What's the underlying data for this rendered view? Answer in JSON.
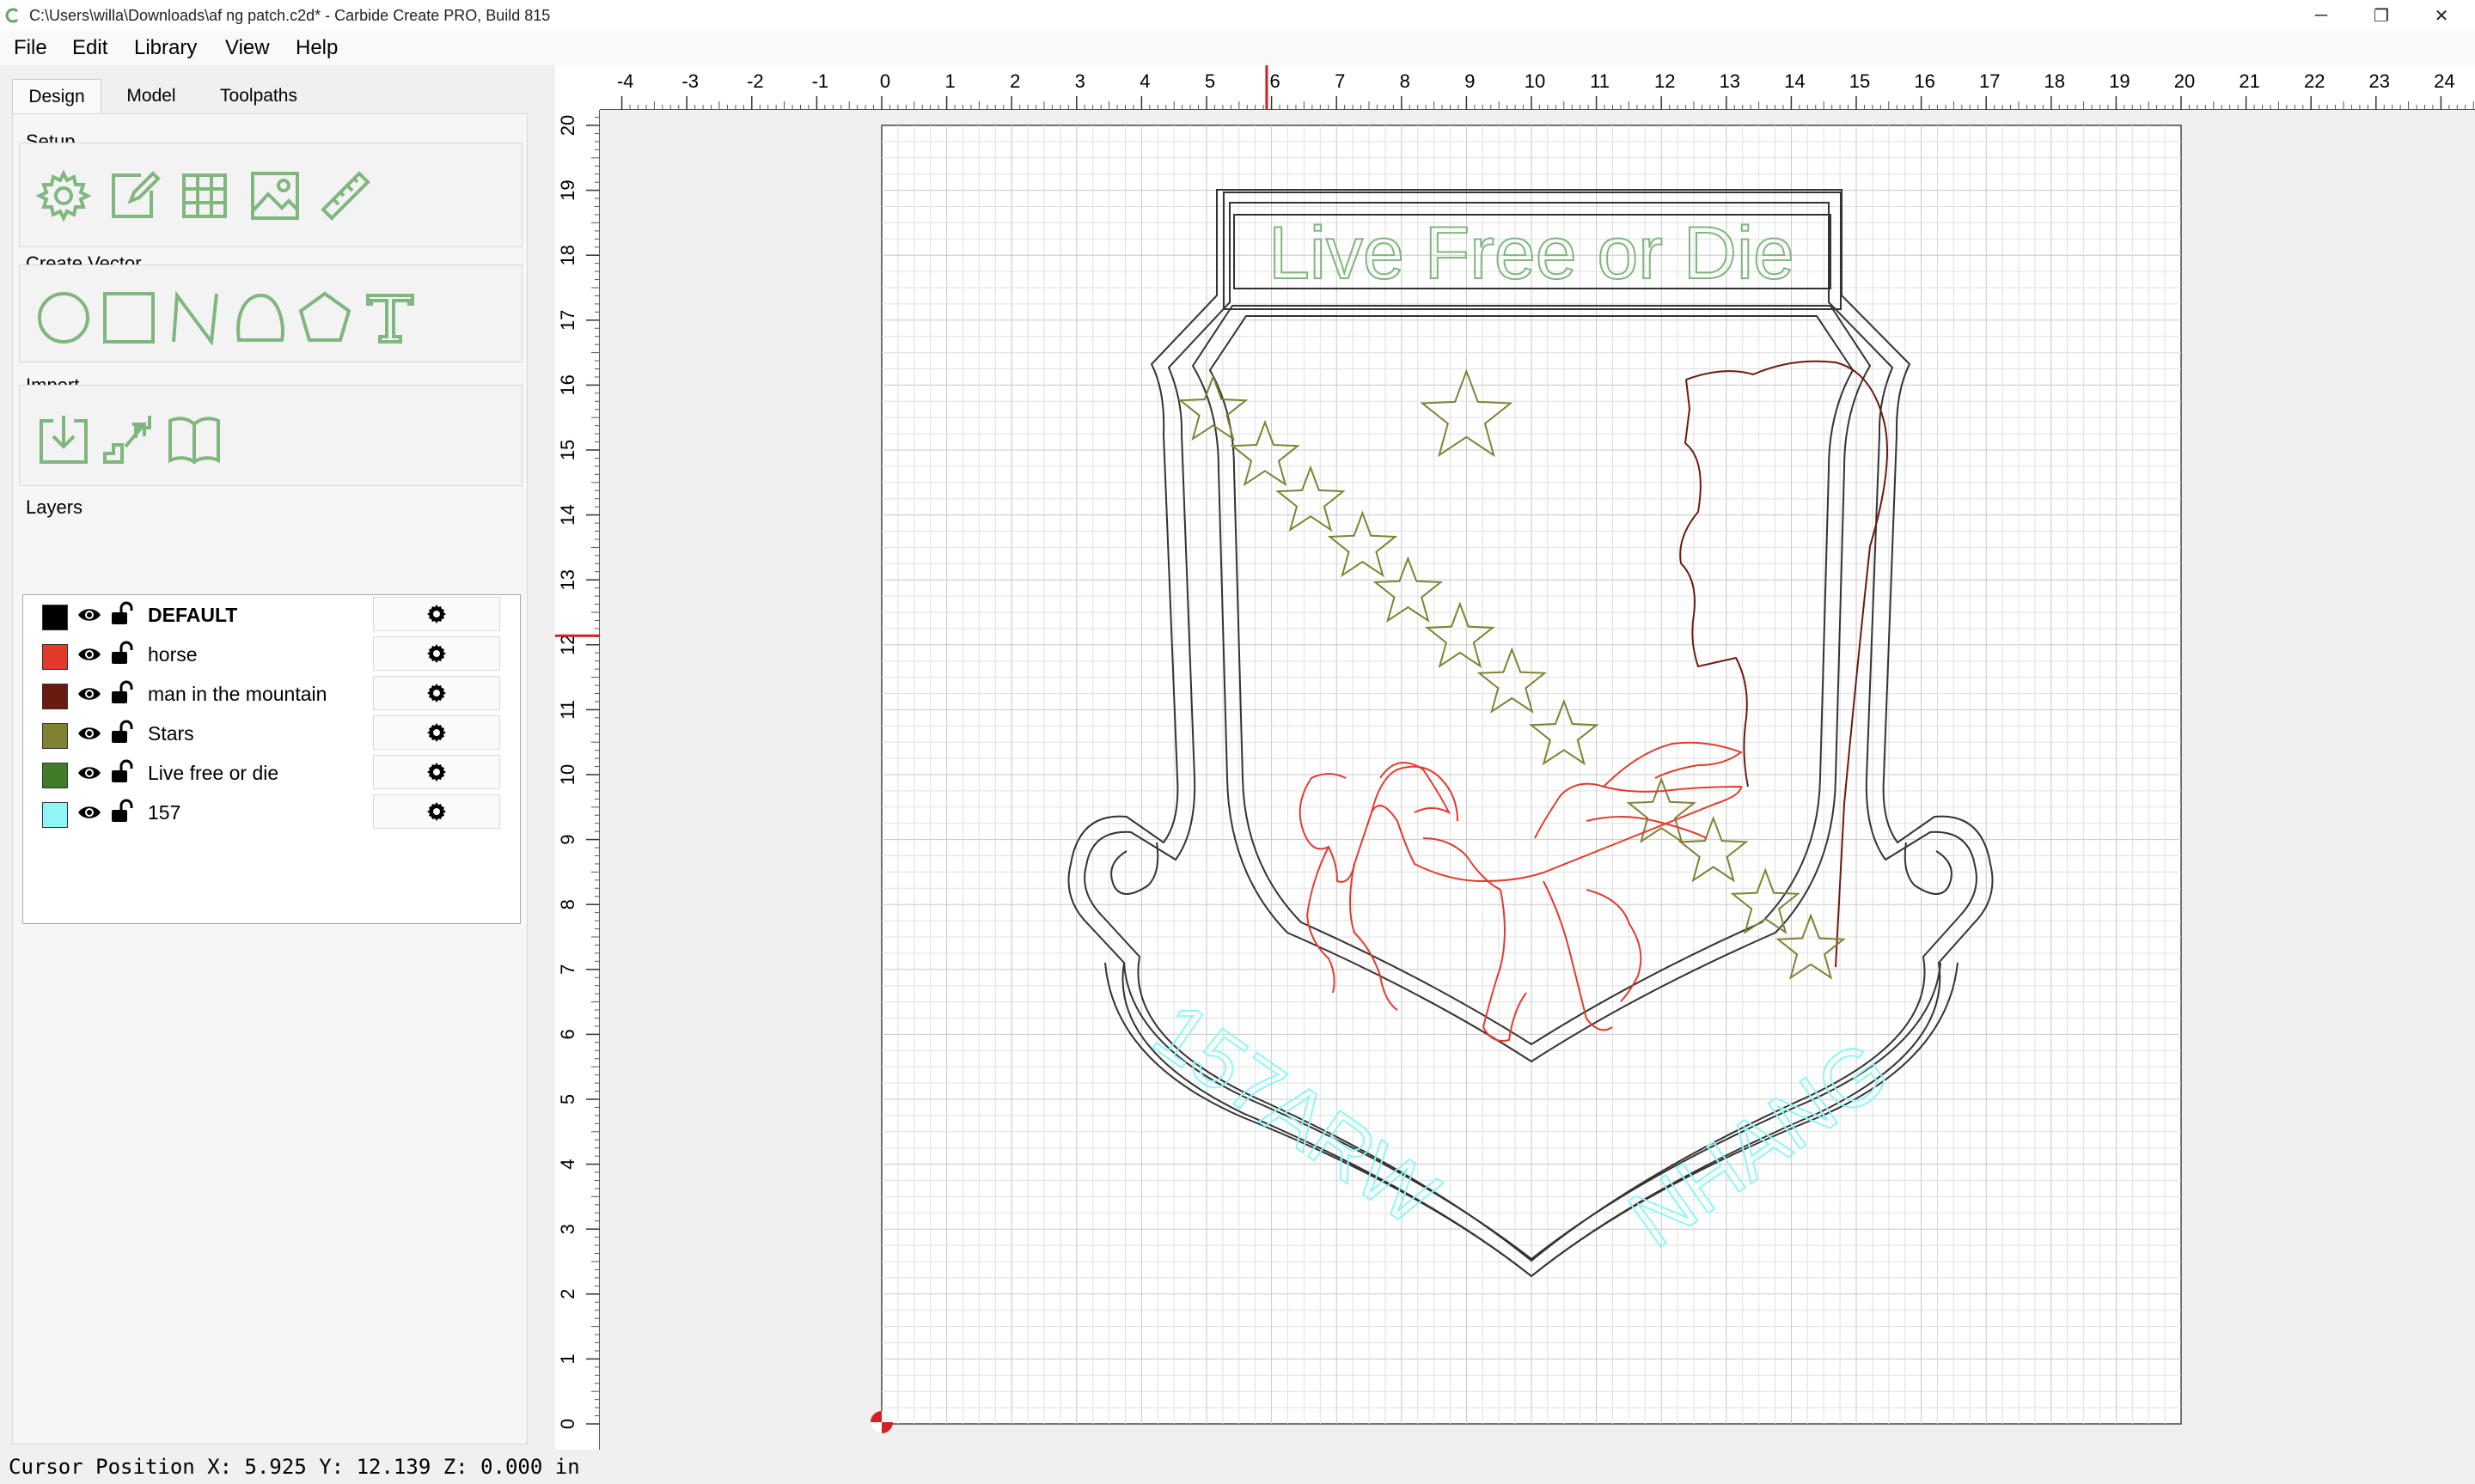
{
  "window": {
    "title": "C:\\Users\\willa\\Downloads\\af ng patch.c2d* - Carbide Create PRO, Build 815",
    "controls": {
      "minimize": "─",
      "maximize": "❐",
      "close": "✕"
    }
  },
  "menu": [
    "File",
    "Edit",
    "Library",
    "View",
    "Help"
  ],
  "tabs": [
    "Design",
    "Model",
    "Toolpaths"
  ],
  "active_tab": "Design",
  "setup": {
    "title": "Setup",
    "tools": [
      "gear-icon",
      "edit-document-icon",
      "grid-icon",
      "image-icon",
      "ruler-icon"
    ]
  },
  "create_vector": {
    "title": "Create Vector",
    "tools": [
      "circle-icon",
      "rectangle-icon",
      "polyline-icon",
      "curve-icon",
      "polygon-icon",
      "text-icon"
    ]
  },
  "import": {
    "title": "Import",
    "tools": [
      "import-icon",
      "import-bitmap-icon",
      "library-icon"
    ]
  },
  "layers": {
    "title": "Layers",
    "items": [
      {
        "name": "DEFAULT",
        "color": "#000000",
        "active": true
      },
      {
        "name": "horse",
        "color": "#e23b2e",
        "active": false
      },
      {
        "name": "man in the mountain",
        "color": "#6b1a10",
        "active": false
      },
      {
        "name": "Stars",
        "color": "#7f8232",
        "active": false
      },
      {
        "name": "Live free or die",
        "color": "#3f7d2a",
        "active": false
      },
      {
        "name": "157",
        "color": "#8ff6f6",
        "active": false
      }
    ]
  },
  "rulers": {
    "x_ticks": [
      -4,
      -3,
      -2,
      -1,
      0,
      1,
      2,
      3,
      4,
      5,
      6,
      7,
      8,
      9,
      10,
      11,
      12,
      13,
      14,
      15,
      16,
      17,
      18,
      19,
      20,
      21,
      22,
      23,
      24
    ],
    "y_ticks": [
      0,
      1,
      2,
      3,
      4,
      5,
      6,
      7,
      8,
      9,
      10,
      11,
      12,
      13,
      14,
      15,
      16,
      17,
      18,
      19,
      20
    ],
    "cursor_x": 5.925,
    "cursor_y": 12.139,
    "stock_width": 20,
    "stock_height": 20
  },
  "canvas_text": {
    "banner": "Live Free or Die",
    "ribbon_left": "157ARW",
    "ribbon_right": "NHANG"
  },
  "status": {
    "text": "Cursor Position X: 5.925 Y: 12.139 Z: 0.000 in"
  },
  "colors": {
    "accent": "#7fb77e",
    "cursor_marker": "#d42020"
  }
}
